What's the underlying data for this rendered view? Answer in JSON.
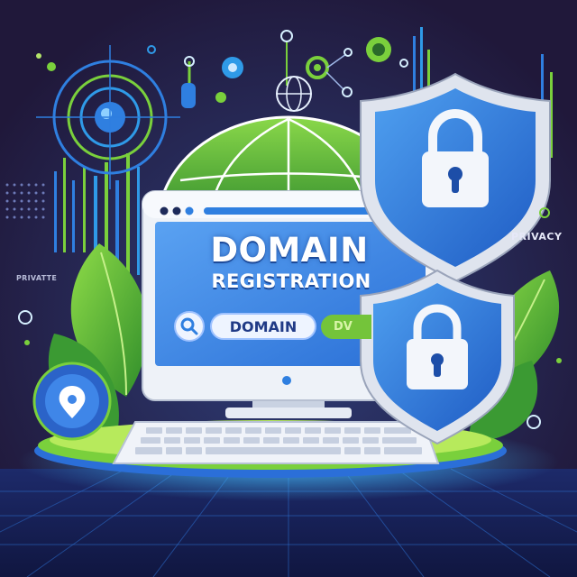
{
  "headline": "DOMAIN",
  "subheadline": "REGISTRATION",
  "search": {
    "field_text": "DOMAIN",
    "button_text": "DV"
  },
  "labels": {
    "privacy_right": "PRIVACY",
    "privacy_left": "PRIVATTE"
  },
  "icons": [
    "globe-icon",
    "padlock-icon",
    "shield-icon",
    "magnifier-icon",
    "location-pin-icon",
    "leaf-icon",
    "keyboard-icon",
    "monitor-icon"
  ],
  "colors": {
    "background": "#241a3c",
    "accent_blue": "#2f7fe0",
    "accent_green": "#7ad03c",
    "shield_silver": "#dfe4ee",
    "screen_blue": "#3d8ae8"
  }
}
